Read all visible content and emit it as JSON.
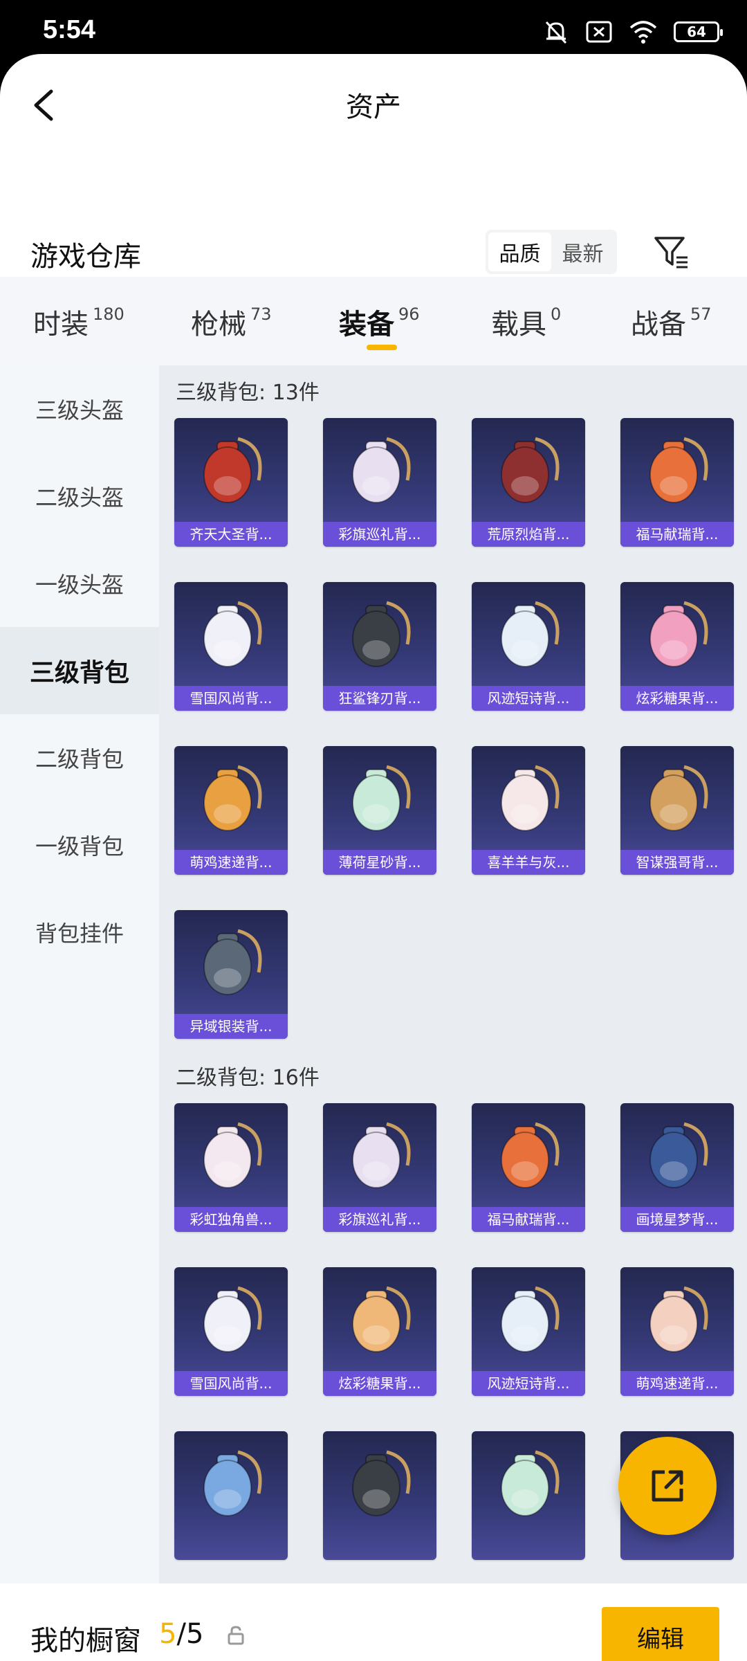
{
  "status_bar": {
    "time": "5:54",
    "battery": "64"
  },
  "nav": {
    "title": "资产"
  },
  "section": {
    "title": "游戏仓库",
    "sort_options": [
      "品质",
      "最新"
    ],
    "sort_active": "品质"
  },
  "tabs": [
    {
      "label": "时装",
      "count": "180"
    },
    {
      "label": "枪械",
      "count": "73"
    },
    {
      "label": "装备",
      "count": "96"
    },
    {
      "label": "载具",
      "count": "0"
    },
    {
      "label": "战备",
      "count": "57"
    }
  ],
  "active_tab": "装备",
  "sidebar": {
    "items": [
      "三级头盔",
      "二级头盔",
      "一级头盔",
      "三级背包",
      "二级背包",
      "一级背包",
      "背包挂件"
    ],
    "active": "三级背包"
  },
  "groups": [
    {
      "title": "三级背包: 13件",
      "items": [
        {
          "name": "齐天大圣背...",
          "icon": "monkey-king-backpack",
          "color": "#c0392b"
        },
        {
          "name": "彩旗巡礼背...",
          "icon": "festival-backpack",
          "color": "#e8dff0"
        },
        {
          "name": "荒原烈焰背...",
          "icon": "flame-backpack",
          "color": "#8e3030"
        },
        {
          "name": "福马献瑞背...",
          "icon": "horse-backpack",
          "color": "#e8703a"
        },
        {
          "name": "雪国风尚背...",
          "icon": "snowman-backpack",
          "color": "#f0f0f8"
        },
        {
          "name": "狂鲨锋刃背...",
          "icon": "shark-backpack",
          "color": "#3a3f46"
        },
        {
          "name": "风迹短诗背...",
          "icon": "wind-backpack",
          "color": "#e6eef8"
        },
        {
          "name": "炫彩糖果背...",
          "icon": "candy-backpack",
          "color": "#f2a0c0"
        },
        {
          "name": "萌鸡速递背...",
          "icon": "chick-backpack",
          "color": "#e8a040"
        },
        {
          "name": "薄荷星砂背...",
          "icon": "mint-backpack",
          "color": "#c8ead8"
        },
        {
          "name": "喜羊羊与灰...",
          "icon": "sheep-backpack",
          "color": "#f6e8e8"
        },
        {
          "name": "智谋强哥背...",
          "icon": "bear-backpack",
          "color": "#d4a060"
        },
        {
          "name": "异域银装背...",
          "icon": "silver-backpack",
          "color": "#5a6878"
        }
      ]
    },
    {
      "title": "二级背包: 16件",
      "items": [
        {
          "name": "彩虹独角兽...",
          "icon": "unicorn-backpack",
          "color": "#f4e8f0"
        },
        {
          "name": "彩旗巡礼背...",
          "icon": "festival-backpack",
          "color": "#e8dff0"
        },
        {
          "name": "福马献瑞背...",
          "icon": "horse-backpack",
          "color": "#e8703a"
        },
        {
          "name": "画境星梦背...",
          "icon": "dream-backpack",
          "color": "#3a5a9a"
        },
        {
          "name": "雪国风尚背...",
          "icon": "snowman-backpack",
          "color": "#f0f0f8"
        },
        {
          "name": "炫彩糖果背...",
          "icon": "candy-backpack",
          "color": "#f0b878"
        },
        {
          "name": "风迹短诗背...",
          "icon": "wind-backpack",
          "color": "#e6eef8"
        },
        {
          "name": "萌鸡速递背...",
          "icon": "chick-backpack",
          "color": "#f4d0c0"
        },
        {
          "name": "",
          "icon": "mecha-backpack",
          "color": "#7aa8e0"
        },
        {
          "name": "",
          "icon": "shark-backpack",
          "color": "#3a3f46"
        },
        {
          "name": "",
          "icon": "mint-backpack",
          "color": "#c8ead8"
        },
        {
          "name": "",
          "icon": "silver-backpack",
          "color": "#5a6878"
        }
      ]
    }
  ],
  "bottom": {
    "title": "我的橱窗",
    "current": "5",
    "separator": "/",
    "total": "5",
    "edit_label": "编辑"
  },
  "colors": {
    "accent": "#f8b500",
    "card_label": "#6a4fd8"
  }
}
